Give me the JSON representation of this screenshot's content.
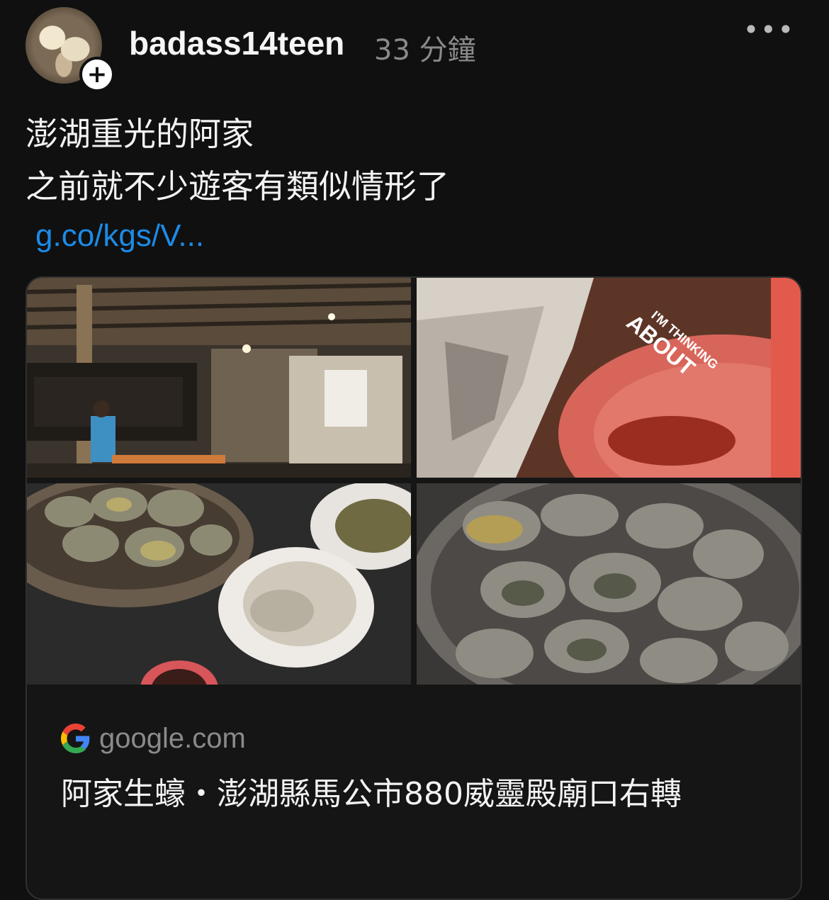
{
  "post": {
    "username": "badass14teen",
    "time": "33 分鐘",
    "more_label": "•••",
    "follow_label": "+",
    "text_lines": [
      "澎湖重光的阿家",
      "之前就不少遊客有類似情形了"
    ],
    "link": "g.co/kgs/V..."
  },
  "card": {
    "images": [
      {
        "label": "restaurant-interior"
      },
      {
        "label": "stylized-food-closeup",
        "overlay_text": "I'M THINKING ABOUT"
      },
      {
        "label": "oysters-and-plates"
      },
      {
        "label": "grilled-oysters-in-pan"
      }
    ],
    "source_domain": "google.com",
    "title": "阿家生蠔・澎湖縣馬公市880威靈殿廟口右轉"
  },
  "icons": {
    "more": "more-options-icon",
    "follow": "plus-icon",
    "source": "google-g-icon"
  }
}
